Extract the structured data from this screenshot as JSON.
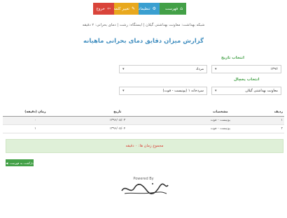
{
  "nav": {
    "items": [
      {
        "label": "فهرست",
        "icon": "home-icon",
        "glyph": "⌂",
        "color": "#43a047"
      },
      {
        "label": "تنظیمات",
        "icon": "gear-icon",
        "glyph": "⚙",
        "color": "#3a9fd0"
      },
      {
        "label": "تغییر کلمه عبور",
        "icon": "lock-icon",
        "glyph": "✎",
        "color": "#e8a81e"
      },
      {
        "label": "خروج",
        "icon": "logout-icon",
        "glyph": "⇦",
        "color": "#d9443a"
      }
    ]
  },
  "breadcrumb": "شبکه بهداشت: معاونت بهداشتی گیلان | ایستگاه: رشت | دمای بحرانی: ۲ دقیقه",
  "page_title": "گزارش میزان دقایق دمای بحرانی ماهیانه",
  "filters": {
    "date_label": "انتخاب تاریخ",
    "year_value": "۱۳۹۶",
    "month_value": "مرداد",
    "vaccine_label": "انتخاب یخچال",
    "org_value": "معاونت بهداشتی گیلان",
    "fridge_value": "سردخانه ۱ (یونیست - فوت)"
  },
  "table": {
    "headers": {
      "num": "ردیف",
      "spec": "مشخصات",
      "date": "تاریخ",
      "time": "زمان (دقیقه)"
    },
    "rows": [
      {
        "num": "۱",
        "spec": "یونیست - فوت",
        "date": "۱۳۹۶/۰۵/۰۳",
        "time": "۰"
      },
      {
        "num": "۲",
        "spec": "یونیست - فوت",
        "date": "۱۳۹۶/۰۵/۰۴",
        "time": "۱"
      }
    ]
  },
  "total_text": "مجموع زمان ها: ۰ دقیقه",
  "back_label": "بازگشت به فهرست",
  "powered_by": "Powered By",
  "logo_text": "سامانه"
}
